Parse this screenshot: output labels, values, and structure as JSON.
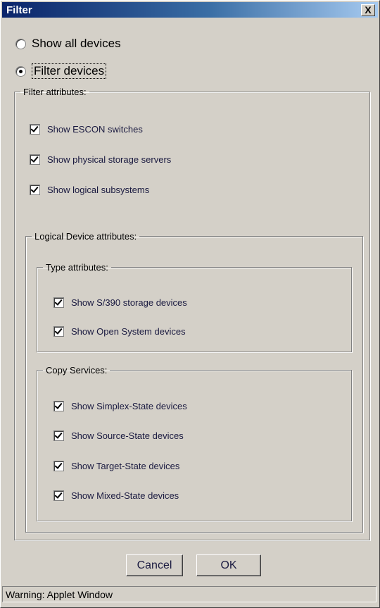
{
  "window": {
    "title": "Filter",
    "close_label": "X"
  },
  "mode": {
    "options": [
      {
        "label": "Show all devices",
        "selected": false
      },
      {
        "label": "Filter devices",
        "selected": true
      }
    ]
  },
  "filter_attributes": {
    "legend": "Filter attributes:",
    "items": [
      {
        "label": "Show ESCON switches",
        "checked": true
      },
      {
        "label": "Show physical storage servers",
        "checked": true
      },
      {
        "label": "Show logical subsystems",
        "checked": true
      }
    ]
  },
  "logical_device": {
    "legend": "Logical Device attributes:",
    "type_attributes": {
      "legend": "Type attributes:",
      "items": [
        {
          "label": "Show S/390 storage devices",
          "checked": true
        },
        {
          "label": "Show Open System devices",
          "checked": true
        }
      ]
    },
    "copy_services": {
      "legend": "Copy Services:",
      "items": [
        {
          "label": "Show Simplex-State devices",
          "checked": true
        },
        {
          "label": "Show Source-State devices",
          "checked": true
        },
        {
          "label": "Show Target-State devices",
          "checked": true
        },
        {
          "label": "Show Mixed-State devices",
          "checked": true
        }
      ]
    }
  },
  "buttons": {
    "cancel": "Cancel",
    "ok": "OK"
  },
  "status": {
    "text": "Warning: Applet Window"
  }
}
